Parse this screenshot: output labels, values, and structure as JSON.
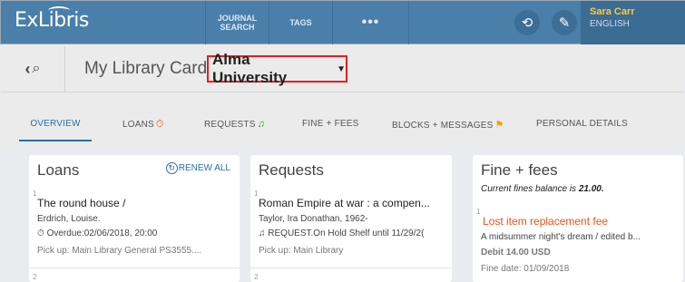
{
  "header": {
    "logo": "ExLibris",
    "nav": [
      {
        "line1": "JOURNAL",
        "line2": "SEARCH"
      },
      {
        "line1": "TAGS",
        "line2": ""
      },
      {
        "line1": "•••",
        "line2": ""
      }
    ],
    "user": {
      "name": "Sara Carr",
      "language": "ENGLISH"
    }
  },
  "subheader": {
    "title": "My Library Card",
    "institution": "Alma University"
  },
  "tabs": [
    {
      "label": "OVERVIEW",
      "active": true
    },
    {
      "label": "LOANS",
      "icon": "⏱"
    },
    {
      "label": "REQUESTS",
      "icon": "🔔"
    },
    {
      "label": "FINE + FEES"
    },
    {
      "label": "BLOCKS + MESSAGES",
      "icon": "⚑"
    },
    {
      "label": "PERSONAL DETAILS"
    }
  ],
  "loans": {
    "title": "Loans",
    "renew_all": "RENEW ALL",
    "items": [
      {
        "index": "1",
        "title": "The round house /",
        "author": "Erdrich, Louise.",
        "status": "Overdue:02/06/2018, 20:00",
        "pickup": "Pick up: Main Library General PS3555...."
      }
    ],
    "next_index": "2"
  },
  "requests": {
    "title": "Requests",
    "items": [
      {
        "index": "1",
        "title": "Roman Empire at war : a compen...",
        "author": "Taylor, Ira Donathan, 1962-",
        "status": "REQUEST.On Hold Shelf until 11/29/2(",
        "pickup": "Pick up: Main Library"
      }
    ],
    "next_index": "2"
  },
  "fines": {
    "title": "Fine + fees",
    "balance_prefix": "Current fines balance is ",
    "balance_value": "21.00.",
    "items": [
      {
        "index": "1",
        "type": "Lost item replacement fee",
        "title": "A midsummer night's dream / edited b...",
        "amount": "Debit 14.00 USD",
        "date": "Fine date: 01/09/2018"
      }
    ]
  },
  "colors": {
    "header": "#4a7faa",
    "accent": "#2a6fa0",
    "overdue": "#e8531a",
    "on_hold": "#3aa02a",
    "highlight_border": "#e02020"
  }
}
